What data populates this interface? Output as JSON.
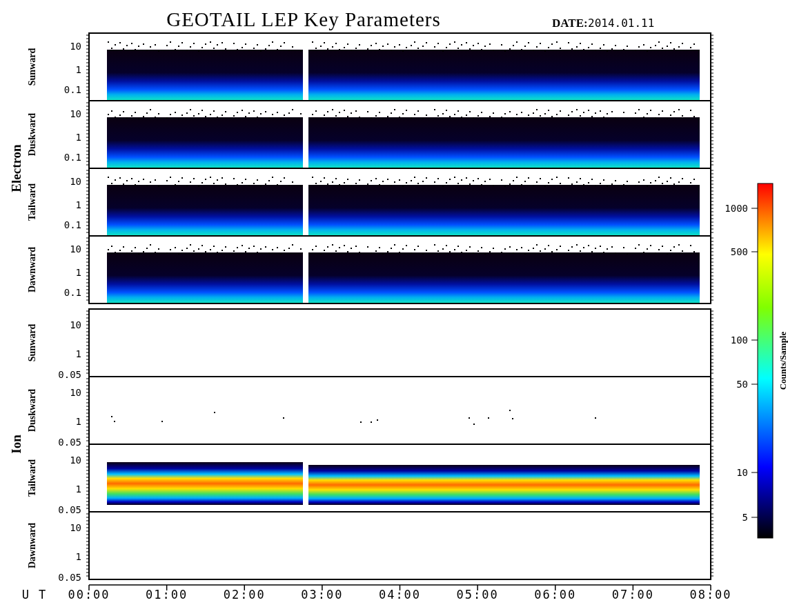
{
  "title": "GEOTAIL LEP Key Parameters",
  "date_label": "DATE:",
  "date": "2014.01.11",
  "groups": [
    {
      "label": "Electron",
      "kind": "electron",
      "panels": [
        {
          "label": "Sunward",
          "kind": "dense",
          "yticks": [
            "10",
            "1",
            "0.1"
          ]
        },
        {
          "label": "Duskward",
          "kind": "dense",
          "yticks": [
            "10",
            "1",
            "0.1"
          ]
        },
        {
          "label": "Tailward",
          "kind": "dense",
          "yticks": [
            "10",
            "1",
            "0.1"
          ]
        },
        {
          "label": "Dawnward",
          "kind": "dense",
          "yticks": [
            "10",
            "1",
            "0.1"
          ]
        }
      ]
    },
    {
      "label": "Ion",
      "kind": "ion",
      "panels": [
        {
          "label": "Sunward",
          "kind": "empty",
          "yticks": [
            "10",
            "1",
            "0.05"
          ]
        },
        {
          "label": "Duskward",
          "kind": "sparse",
          "yticks": [
            "10",
            "1",
            "0.05"
          ]
        },
        {
          "label": "Tailward",
          "kind": "band",
          "yticks": [
            "10",
            "1",
            "0.05"
          ]
        },
        {
          "label": "Dawnward",
          "kind": "empty",
          "yticks": [
            "10",
            "1",
            "0.05"
          ]
        }
      ]
    }
  ],
  "x_axis": {
    "label": "U T",
    "ticks": [
      "00:00",
      "01:00",
      "02:00",
      "03:00",
      "04:00",
      "05:00",
      "06:00",
      "07:00",
      "08:00"
    ]
  },
  "colorbar": {
    "label": "Counts/Sample",
    "ticks": [
      "1000",
      "500",
      "100",
      "50",
      "10",
      "5"
    ]
  }
}
